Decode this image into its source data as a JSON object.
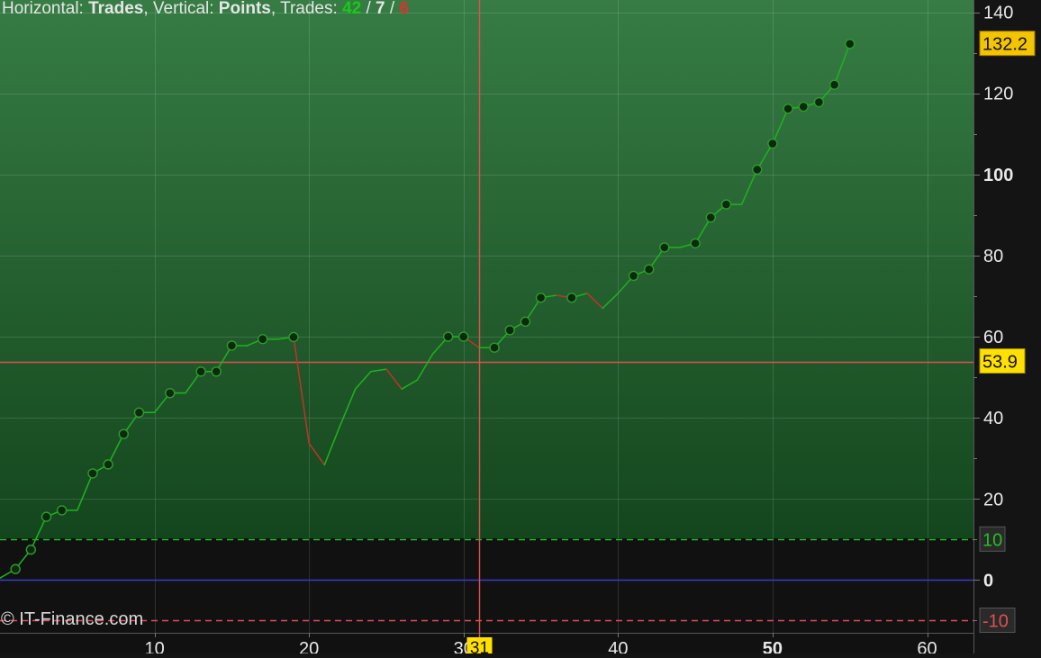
{
  "header": {
    "horizontal_prefix": "Horizontal: ",
    "horizontal_value": "Trades",
    "vertical_prefix": ", Vertical: ",
    "vertical_value": "Points",
    "trades_prefix": ", Trades: ",
    "trades_total": "42",
    "separator": " / ",
    "trades_mid": "7",
    "trades_red": "6"
  },
  "copyright": "© IT-Finance.com",
  "colors": {
    "rising": "#1fb21f",
    "falling": "#c8302a",
    "crosshair": "#e05050",
    "zero_line": "#3a3ad0",
    "upper_band": "#22c022",
    "lower_band": "#e05050",
    "label_yellow": "#ffe000",
    "marker": "#0b2a0b"
  },
  "chart_data": {
    "type": "line",
    "xlabel": "",
    "ylabel": "",
    "xlim": [
      0,
      63
    ],
    "ylim": [
      -13,
      143
    ],
    "x_ticks": [
      "10",
      "20",
      "30",
      "40",
      "50",
      "60"
    ],
    "x_tick_values": [
      10,
      20,
      30,
      40,
      50,
      60
    ],
    "x_bold_tick": "50",
    "y_ticks": [
      "140",
      "120",
      "100",
      "80",
      "60",
      "40",
      "20",
      "0"
    ],
    "y_tick_values": [
      140,
      120,
      100,
      80,
      60,
      40,
      20,
      0
    ],
    "y_bold_ticks": [
      "100",
      "0"
    ],
    "grid": true,
    "series": [
      {
        "x": [
          0,
          1,
          2,
          3,
          4,
          5,
          6,
          7,
          8,
          9,
          10,
          11,
          12,
          13,
          14,
          15,
          16,
          17,
          18,
          19,
          20,
          21,
          22,
          23,
          24,
          25,
          26,
          27,
          28,
          29,
          30,
          31,
          32,
          33,
          34,
          35,
          36,
          37,
          38,
          39,
          40,
          41,
          42,
          43,
          44,
          45,
          46,
          47,
          48,
          49,
          50,
          51,
          52,
          53,
          54,
          55
        ],
        "y": [
          0.5,
          2.7,
          7.5,
          15.6,
          17.2,
          17.2,
          26.3,
          28.5,
          36.0,
          41.3,
          41.3,
          46.1,
          46.1,
          51.4,
          51.4,
          57.8,
          57.8,
          59.4,
          59.4,
          59.9,
          33.7,
          28.4,
          38.0,
          47.1,
          51.4,
          52.0,
          47.1,
          49.3,
          55.7,
          60.0,
          60.0,
          57.3,
          57.3,
          61.6,
          63.7,
          69.6,
          70.2,
          69.6,
          70.7,
          67.0,
          70.7,
          75.0,
          76.6,
          82.0,
          82.0,
          83.0,
          89.4,
          92.6,
          92.6,
          101.2,
          107.6,
          116.2,
          116.7,
          117.8,
          122.1,
          132.2
        ]
      }
    ],
    "marker_x": [
      1,
      2,
      3,
      4,
      6,
      7,
      8,
      9,
      11,
      13,
      14,
      15,
      17,
      19,
      29,
      30,
      32,
      33,
      34,
      35,
      37,
      41,
      42,
      43,
      45,
      46,
      47,
      49,
      50,
      51,
      52,
      53,
      54,
      55
    ],
    "reference_lines": [
      {
        "label": "10",
        "y": 10,
        "style": "dashed",
        "color_key": "upper_band"
      },
      {
        "label": "0",
        "y": 0,
        "style": "solid",
        "color_key": "zero_line"
      },
      {
        "label": "-10",
        "y": -10,
        "style": "dashed",
        "color_key": "lower_band"
      }
    ],
    "crosshair": {
      "x": 31,
      "x_label": "31",
      "y": 53.9,
      "y_label": "53.9"
    },
    "last_value": {
      "y": 132.2,
      "label": "132.2"
    }
  }
}
